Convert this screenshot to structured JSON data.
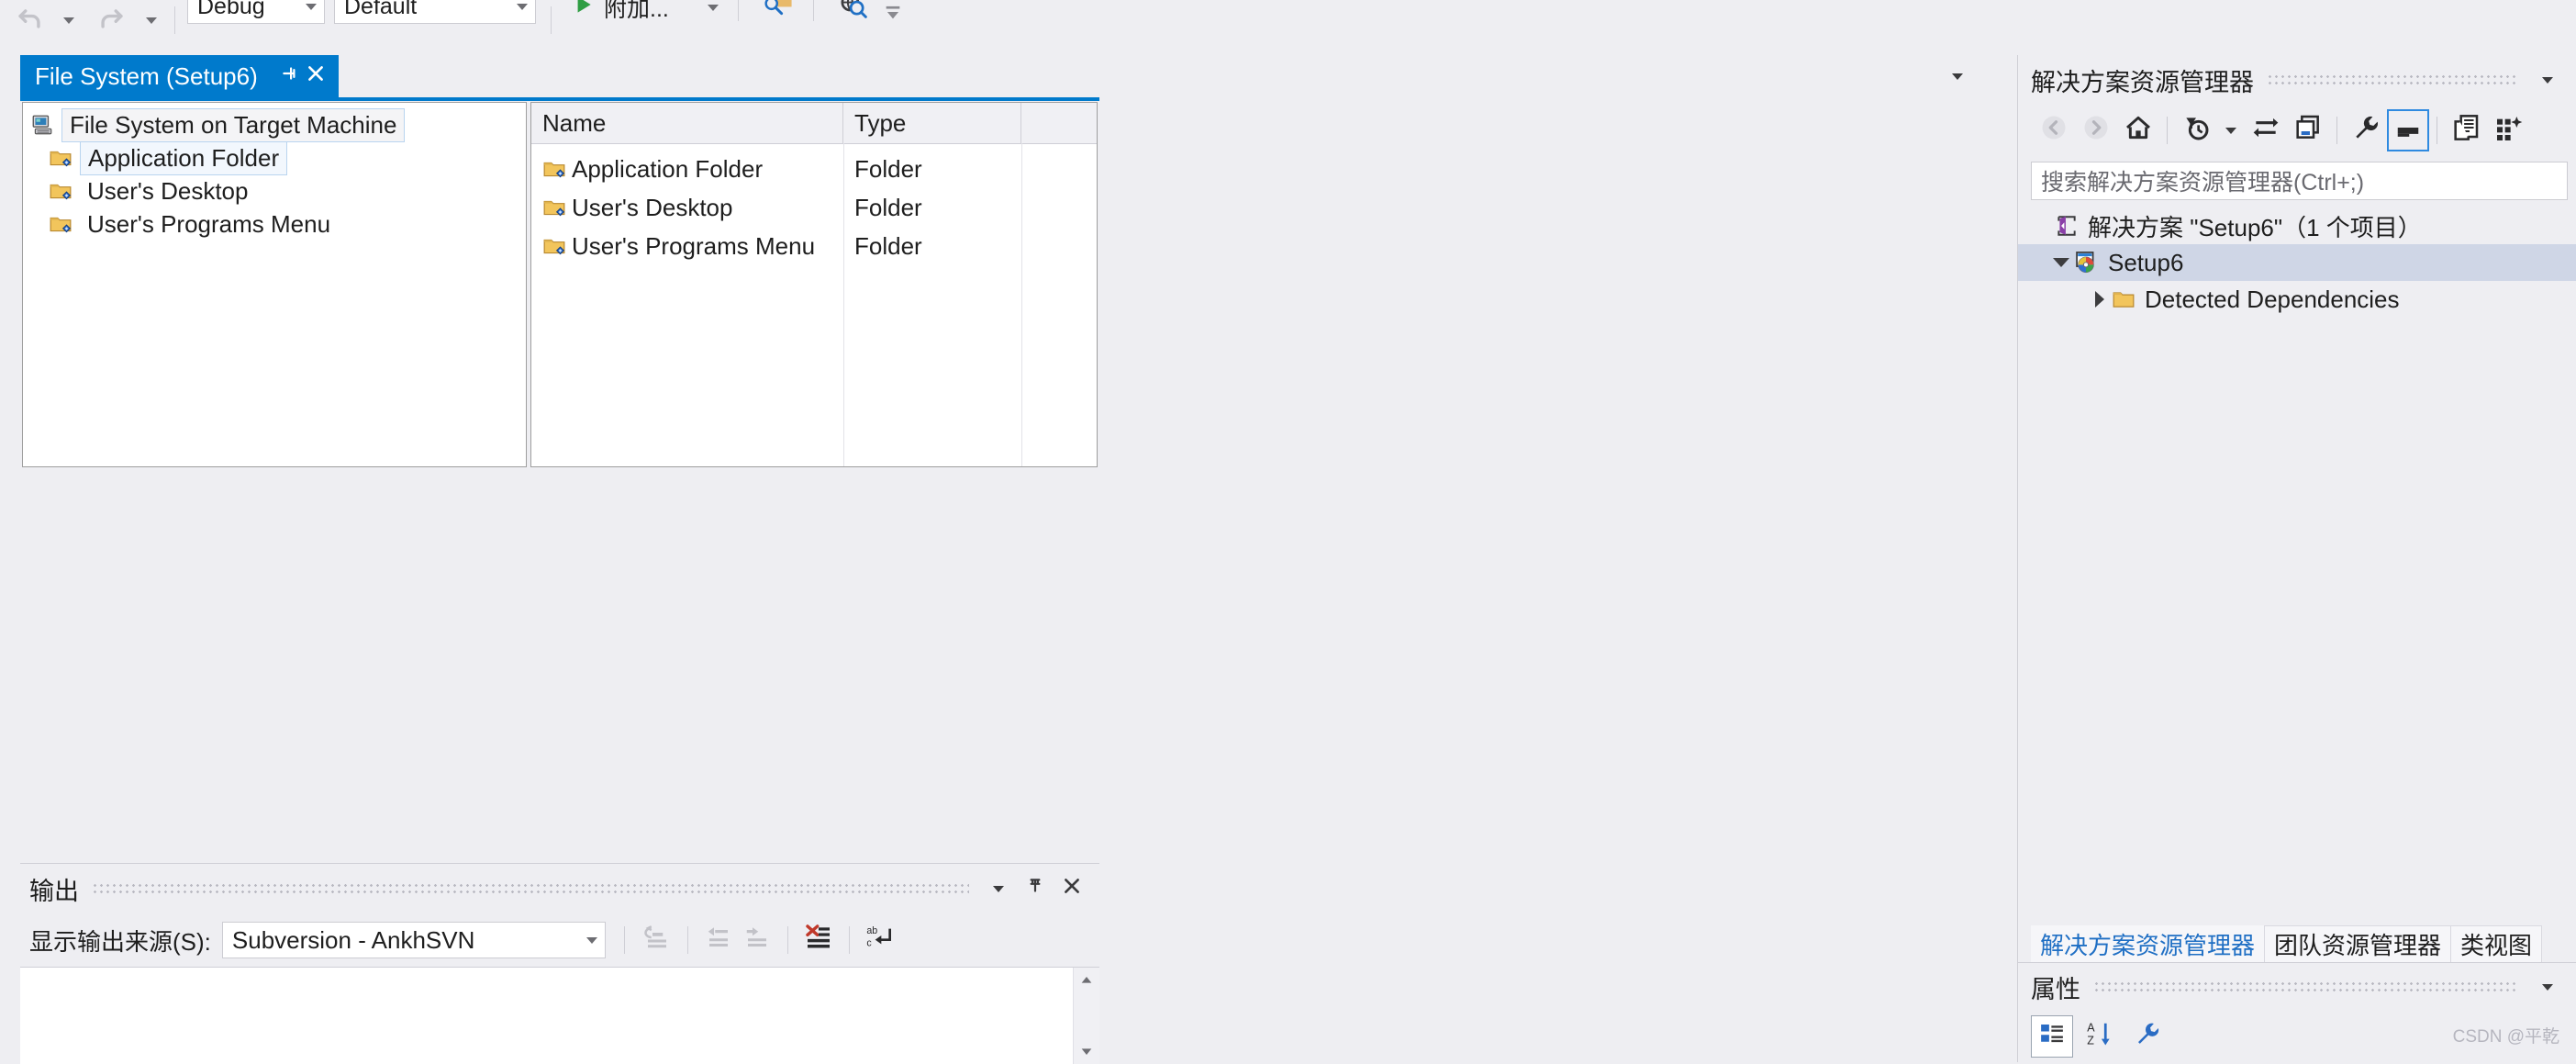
{
  "toolbar": {
    "undo_icon": "undo-arrow-icon",
    "undo_dropdown_icon": "chevron-down-icon",
    "redo_icon": "redo-arrow-icon",
    "redo_dropdown_icon": "chevron-down-icon",
    "config_combo": {
      "value": "Debug",
      "dropdown_icon": "chevron-down-icon"
    },
    "platform_combo": {
      "value": "Default",
      "dropdown_icon": "chevron-down-icon"
    },
    "start_button": {
      "label": "附加...",
      "play_icon": "play-triangle-icon",
      "dropdown_icon": "chevron-down-icon"
    },
    "find_in_files_icon": "find-in-files-icon",
    "web_search_icon": "globe-search-icon",
    "overflow_icon": "toolbar-overflow-icon"
  },
  "document_tab": {
    "title": "File System (Setup6)",
    "pin_icon": "pin-icon",
    "close_icon": "close-icon",
    "dropdown_icon": "chevron-down-icon"
  },
  "designer": {
    "tree": {
      "root": {
        "label": "File System on Target Machine",
        "icon": "target-machine-icon"
      },
      "children": [
        {
          "label": "Application Folder",
          "icon": "special-folder-icon",
          "selected": true
        },
        {
          "label": "User's Desktop",
          "icon": "special-folder-icon",
          "selected": false
        },
        {
          "label": "User's Programs Menu",
          "icon": "special-folder-icon",
          "selected": false
        }
      ]
    },
    "list": {
      "columns": [
        "Name",
        "Type"
      ],
      "rows": [
        {
          "name": "Application Folder",
          "type": "Folder",
          "icon": "special-folder-icon"
        },
        {
          "name": "User's Desktop",
          "type": "Folder",
          "icon": "special-folder-icon"
        },
        {
          "name": "User's Programs Menu",
          "type": "Folder",
          "icon": "special-folder-icon"
        }
      ]
    }
  },
  "output_panel": {
    "title": "输出",
    "dropdown_icon": "chevron-down-icon",
    "pin_icon": "pin-icon",
    "close_icon": "close-icon",
    "source_label": "显示输出来源(S):",
    "source_value": "Subversion - AnkhSVN",
    "source_dropdown_icon": "chevron-down-icon",
    "tools": [
      {
        "name": "go-to-message-icon",
        "enabled": false
      },
      {
        "name": "previous-message-icon",
        "enabled": false
      },
      {
        "name": "next-message-icon",
        "enabled": false
      },
      {
        "name": "clear-all-icon",
        "enabled": true
      },
      {
        "name": "toggle-word-wrap-icon",
        "enabled": true
      }
    ],
    "scroll_up_icon": "scroll-up-arrow-icon",
    "scroll_down_icon": "scroll-down-arrow-icon"
  },
  "solution_explorer": {
    "title": "解决方案资源管理器",
    "header_dropdown_icon": "chevron-down-icon",
    "toolbar": [
      {
        "name": "back-arrow-icon",
        "enabled": false
      },
      {
        "name": "forward-arrow-icon",
        "enabled": false
      },
      {
        "name": "home-icon",
        "enabled": true
      },
      {
        "name": "pending-changes-filter-icon",
        "enabled": true
      },
      {
        "name": "filter-dropdown-icon",
        "enabled": true
      },
      {
        "name": "sync-with-active-document-icon",
        "enabled": true
      },
      {
        "name": "refresh-collapse-icon",
        "enabled": true
      },
      {
        "name": "properties-wrench-icon",
        "enabled": true
      },
      {
        "name": "preview-selected-items-icon",
        "enabled": true,
        "active": true
      },
      {
        "name": "show-all-files-icon",
        "enabled": true
      },
      {
        "name": "new-solution-view-icon",
        "enabled": true
      }
    ],
    "search_placeholder": "搜索解决方案资源管理器(Ctrl+;)",
    "tree": [
      {
        "label": "解决方案 \"Setup6\"（1 个项目）",
        "icon": "solution-icon",
        "indent": 1,
        "expander": "none",
        "selected": false
      },
      {
        "label": "Setup6",
        "icon": "setup-project-icon",
        "indent": 2,
        "expander": "down",
        "selected": true
      },
      {
        "label": "Detected Dependencies",
        "icon": "folder-icon",
        "indent": 3,
        "expander": "right",
        "selected": false
      }
    ],
    "tabs": [
      {
        "label": "解决方案资源管理器",
        "active": true
      },
      {
        "label": "团队资源管理器",
        "active": false
      },
      {
        "label": "类视图",
        "active": false
      }
    ]
  },
  "properties_panel": {
    "title": "属性",
    "dropdown_icon": "chevron-down-icon",
    "tools": [
      {
        "name": "categorized-view-icon",
        "active": true
      },
      {
        "name": "alphabetical-sort-icon",
        "active": false
      },
      {
        "name": "property-pages-wrench-icon",
        "active": false
      }
    ]
  },
  "watermark": {
    "text": "CSDN @平乾"
  },
  "colors": {
    "accent_blue": "#007acc",
    "toolbar_bg": "#eeeef2",
    "selection": "#cfd6e6",
    "folder_yellow": "#f2c55c",
    "play_green": "#2f9e44",
    "clear_red": "#c0392b",
    "link_blue": "#1f6fc4"
  }
}
